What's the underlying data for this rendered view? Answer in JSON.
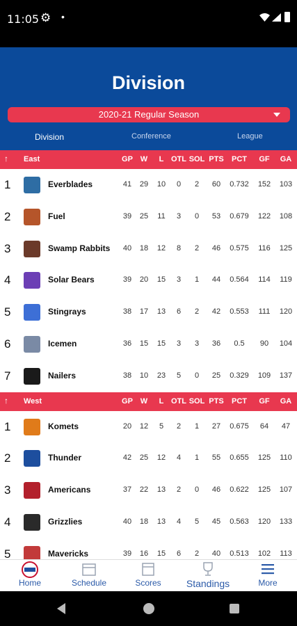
{
  "status": {
    "time": "11:05"
  },
  "header": {
    "title": "Division",
    "season": "2020-21 Regular Season",
    "tabs": [
      "Division",
      "Conference",
      "League"
    ],
    "color": "#0b4a9a"
  },
  "accent_color": "#e8384f",
  "columns": [
    "GP",
    "W",
    "L",
    "OTL",
    "SOL",
    "PTS",
    "PCT",
    "GF",
    "GA"
  ],
  "groups": [
    {
      "name": "East",
      "teams": [
        {
          "rank": "1",
          "name": "Everblades",
          "color": "#2e6da4",
          "stats": [
            "41",
            "29",
            "10",
            "0",
            "2",
            "60",
            "0.732",
            "152",
            "103"
          ]
        },
        {
          "rank": "2",
          "name": "Fuel",
          "color": "#b5552a",
          "stats": [
            "39",
            "25",
            "11",
            "3",
            "0",
            "53",
            "0.679",
            "122",
            "108"
          ]
        },
        {
          "rank": "3",
          "name": "Swamp Rabbits",
          "color": "#6b3a2a",
          "stats": [
            "40",
            "18",
            "12",
            "8",
            "2",
            "46",
            "0.575",
            "116",
            "125"
          ]
        },
        {
          "rank": "4",
          "name": "Solar Bears",
          "color": "#6c3fb5",
          "stats": [
            "39",
            "20",
            "15",
            "3",
            "1",
            "44",
            "0.564",
            "114",
            "119"
          ]
        },
        {
          "rank": "5",
          "name": "Stingrays",
          "color": "#3d6fd6",
          "stats": [
            "38",
            "17",
            "13",
            "6",
            "2",
            "42",
            "0.553",
            "111",
            "120"
          ]
        },
        {
          "rank": "6",
          "name": "Icemen",
          "color": "#7a8aa5",
          "stats": [
            "36",
            "15",
            "15",
            "3",
            "3",
            "36",
            "0.5",
            "90",
            "104"
          ]
        },
        {
          "rank": "7",
          "name": "Nailers",
          "color": "#1a1a1a",
          "stats": [
            "38",
            "10",
            "23",
            "5",
            "0",
            "25",
            "0.329",
            "109",
            "137"
          ]
        }
      ]
    },
    {
      "name": "West",
      "teams": [
        {
          "rank": "1",
          "name": "Komets",
          "color": "#e07b1a",
          "stats": [
            "20",
            "12",
            "5",
            "2",
            "1",
            "27",
            "0.675",
            "64",
            "47"
          ]
        },
        {
          "rank": "2",
          "name": "Thunder",
          "color": "#1d4e9e",
          "stats": [
            "42",
            "25",
            "12",
            "4",
            "1",
            "55",
            "0.655",
            "125",
            "110"
          ]
        },
        {
          "rank": "3",
          "name": "Americans",
          "color": "#b3202c",
          "stats": [
            "37",
            "22",
            "13",
            "2",
            "0",
            "46",
            "0.622",
            "125",
            "107"
          ]
        },
        {
          "rank": "4",
          "name": "Grizzlies",
          "color": "#2a2a2a",
          "stats": [
            "40",
            "18",
            "13",
            "4",
            "5",
            "45",
            "0.563",
            "120",
            "133"
          ]
        },
        {
          "rank": "5",
          "name": "Mavericks",
          "color": "#c23a3a",
          "stats": [
            "39",
            "16",
            "15",
            "6",
            "2",
            "40",
            "0.513",
            "102",
            "113"
          ]
        }
      ]
    }
  ],
  "bottom_nav": [
    {
      "label": "Home",
      "icon": "home-logo-icon"
    },
    {
      "label": "Schedule",
      "icon": "calendar-icon"
    },
    {
      "label": "Scores",
      "icon": "scores-calendar-icon"
    },
    {
      "label": "Standings",
      "icon": "trophy-icon",
      "active": true
    },
    {
      "label": "More",
      "icon": "menu-icon"
    }
  ]
}
